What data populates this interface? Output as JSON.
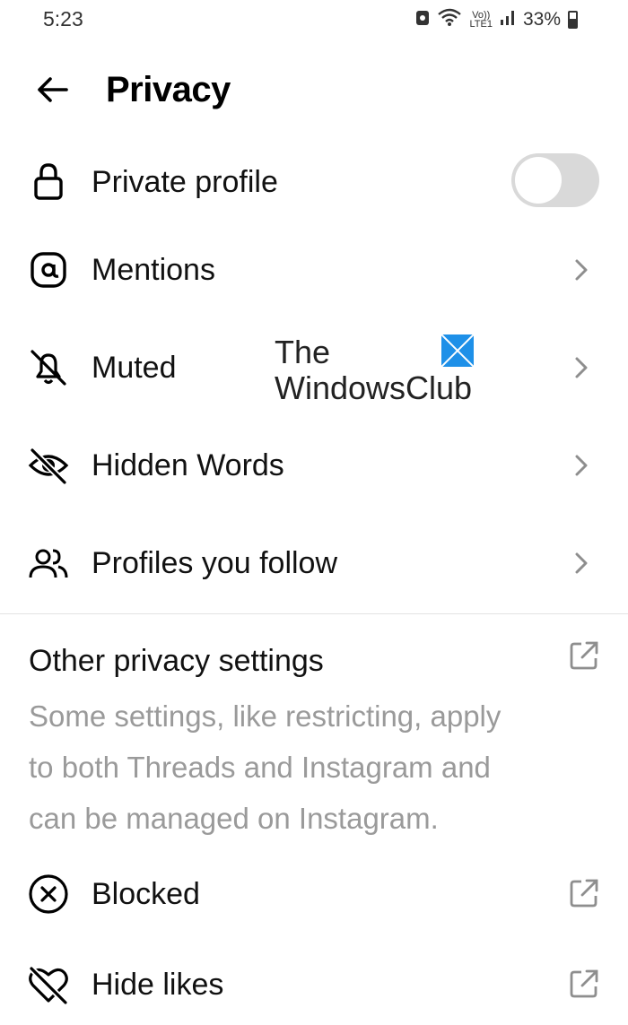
{
  "status_bar": {
    "time": "5:23",
    "network_top": "Vo))",
    "network_bottom": "LTE1",
    "battery": "33%"
  },
  "header": {
    "title": "Privacy",
    "back_icon": "arrow-left-icon"
  },
  "settings": {
    "private_profile": {
      "label": "Private profile",
      "icon": "lock-icon",
      "toggle_on": false
    },
    "mentions": {
      "label": "Mentions",
      "icon": "at-sign-icon"
    },
    "muted": {
      "label": "Muted",
      "icon": "bell-off-icon"
    },
    "hidden_words": {
      "label": "Hidden Words",
      "icon": "eye-off-icon"
    },
    "profiles_you_follow": {
      "label": "Profiles you follow",
      "icon": "people-icon"
    }
  },
  "other_privacy": {
    "title": "Other privacy settings",
    "description": "Some settings, like restricting, apply to both Threads and Instagram and can be managed on Instagram.",
    "items": {
      "blocked": {
        "label": "Blocked",
        "icon": "circle-x-icon"
      },
      "hide_likes": {
        "label": "Hide likes",
        "icon": "heart-off-icon"
      }
    }
  },
  "watermark": {
    "line1": "The",
    "line2": "WindowsClub"
  },
  "colors": {
    "toggle_off": "#d9d9d9",
    "secondary_text": "#9a9a9a",
    "chevron": "#8e8e8e",
    "logo_blue": "#1e90e8"
  }
}
